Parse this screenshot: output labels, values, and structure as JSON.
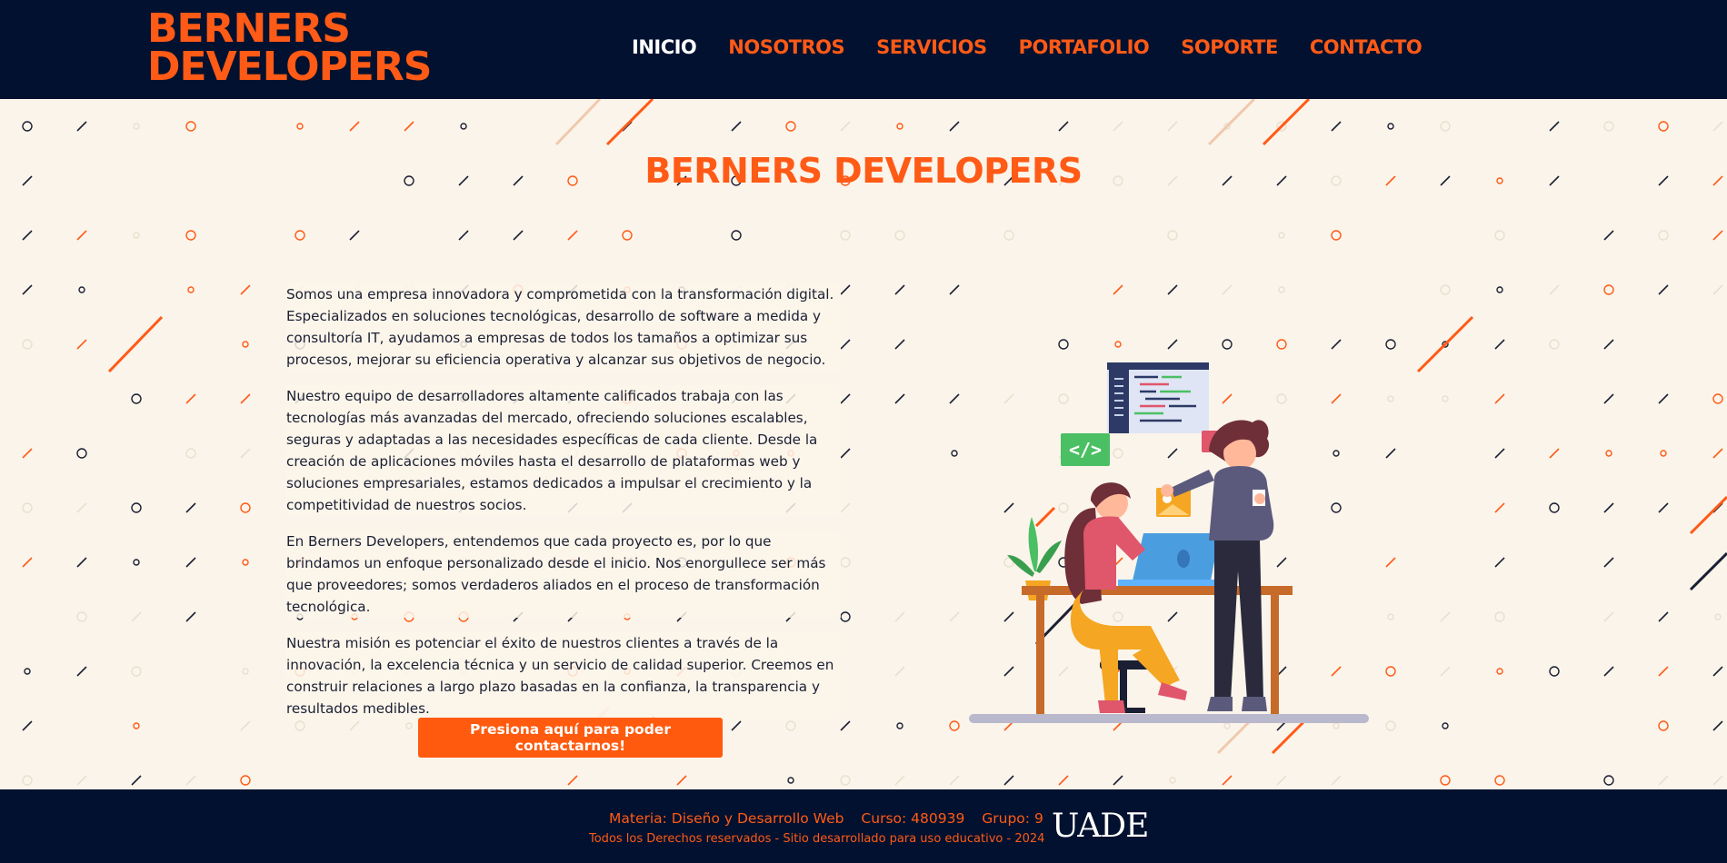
{
  "header": {
    "logo_line1": "BERNERS",
    "logo_line2": "DEVELOPERS",
    "nav": [
      "INICIO",
      "NOSOTROS",
      "SERVICIOS",
      "PORTAFOLIO",
      "SOPORTE",
      "CONTACTO"
    ]
  },
  "main": {
    "title": "BERNERS DEVELOPERS",
    "paragraphs": [
      "Somos una empresa innovadora y comprometida con la transformación digital. Especializados en soluciones tecnológicas, desarrollo de software a medida y consultoría IT, ayudamos a empresas de todos los tamaños a optimizar sus procesos, mejorar su eficiencia operativa y alcanzar sus objetivos de negocio.",
      "Nuestro equipo de desarrolladores altamente calificados trabaja con las tecnologías más avanzadas del mercado, ofreciendo soluciones escalables, seguras y adaptadas a las necesidades específicas de cada cliente. Desde la creación de aplicaciones móviles hasta el desarrollo de plataformas web y soluciones empresariales, estamos dedicados a impulsar el crecimiento y la competitividad de nuestros socios.",
      "En Berners Developers, entendemos que cada proyecto es, por lo que brindamos un enfoque personalizado desde el inicio. Nos enorgullece ser más que proveedores; somos verdaderos aliados en el proceso de transformación tecnológica.",
      "Nuestra misión es potenciar el éxito de nuestros clientes a través de la innovación, la excelencia técnica y un servicio de calidad superior. Creemos en construir relaciones a largo plazo basadas en la confianza, la transparencia y resultados medibles."
    ],
    "cta_label": "Presiona aquí para poder contactarnos!",
    "code_tag": "</>",
    "chat_dots": "•••"
  },
  "footer": {
    "materia": "Materia: Diseño y Desarrollo Web",
    "curso": "Curso: 480939",
    "grupo": "Grupo: 9",
    "rights": "Todos los Derechos reservados - Sitio desarrollado para uso educativo - 2024",
    "uade_logo": "UADE"
  },
  "colors": {
    "navy": "#02112f",
    "accent": "#ff5a16",
    "background": "#fbf4ea",
    "text": "#1a1f33"
  }
}
